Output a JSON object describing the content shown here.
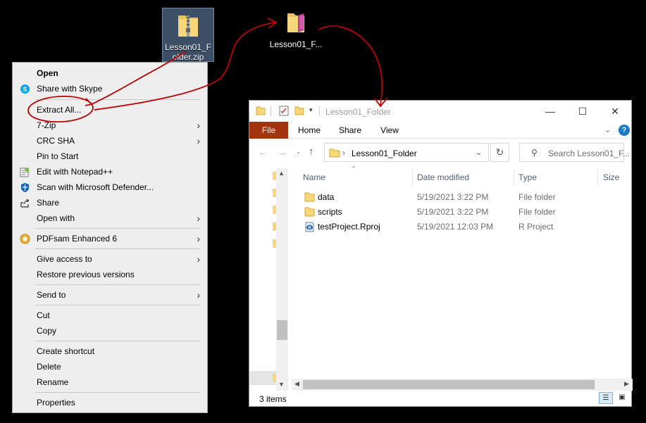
{
  "desktop": {
    "zip_label": "Lesson01_Folder.zip",
    "folder_label": "Lesson01_F..."
  },
  "context_menu": {
    "items": [
      {
        "label": "Open",
        "bold": true,
        "icon": ""
      },
      {
        "label": "Share with Skype",
        "icon": "skype-icon"
      },
      {
        "label": "Extract All...",
        "icon": ""
      },
      {
        "label": "7-Zip",
        "icon": "",
        "submenu": true
      },
      {
        "label": "CRC SHA",
        "icon": "",
        "submenu": true
      },
      {
        "label": "Pin to Start",
        "icon": ""
      },
      {
        "label": "Edit with Notepad++",
        "icon": "notepadpp-icon"
      },
      {
        "label": "Scan with Microsoft Defender...",
        "icon": "defender-icon"
      },
      {
        "label": "Share",
        "icon": "share-icon"
      },
      {
        "label": "Open with",
        "icon": "",
        "submenu": true
      },
      {
        "label": "PDFsam Enhanced 6",
        "icon": "pdfsam-icon",
        "submenu": true
      },
      {
        "label": "Give access to",
        "icon": "",
        "submenu": true
      },
      {
        "label": "Restore previous versions",
        "icon": ""
      },
      {
        "label": "Send to",
        "icon": "",
        "submenu": true
      },
      {
        "label": "Cut",
        "icon": ""
      },
      {
        "label": "Copy",
        "icon": ""
      },
      {
        "label": "Create shortcut",
        "icon": ""
      },
      {
        "label": "Delete",
        "icon": ""
      },
      {
        "label": "Rename",
        "icon": ""
      },
      {
        "label": "Properties",
        "icon": ""
      }
    ],
    "submenu_arrow": "›"
  },
  "explorer": {
    "title": "Lesson01_Folder",
    "tabs": {
      "file": "File",
      "home": "Home",
      "share": "Share",
      "view": "View"
    },
    "address": "Lesson01_Folder",
    "search_placeholder": "Search Lesson01_F...",
    "columns": {
      "name": "Name",
      "date": "Date modified",
      "type": "Type",
      "size": "Size"
    },
    "files": [
      {
        "name": "data",
        "date": "5/19/2021 3:22 PM",
        "type": "File folder",
        "icon": "folder-icon"
      },
      {
        "name": "scripts",
        "date": "5/19/2021 3:22 PM",
        "type": "File folder",
        "icon": "folder-icon"
      },
      {
        "name": "testProject.Rproj",
        "date": "5/19/2021 12:03 PM",
        "type": "R Project",
        "icon": "rproject-icon"
      }
    ],
    "status": "3 items"
  },
  "colors": {
    "annotation": "#c00000",
    "file_tab": "#a3330e"
  }
}
